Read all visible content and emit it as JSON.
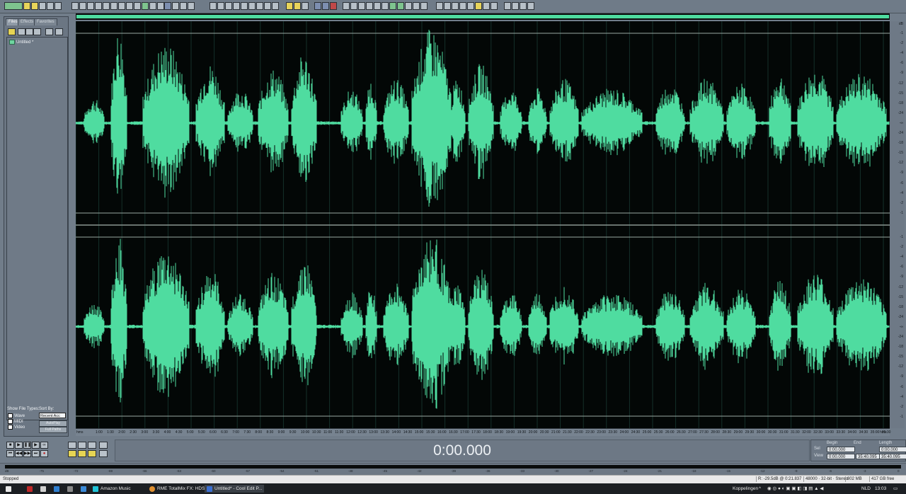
{
  "organizer": {
    "tabs": [
      "Files",
      "Effects",
      "Favorites"
    ],
    "files": [
      "Untitled *"
    ],
    "show_file_types_label": "Show File Types:",
    "sort_by_label": "Sort By:",
    "sort_value": "Recent Acc",
    "file_types": [
      "Wave",
      "MIDI",
      "Video"
    ],
    "autoplay_label": "AutoPlay",
    "full_paths_label": "Full Paths"
  },
  "time_display": "0:00.000",
  "selection": {
    "headers": [
      "Begin",
      "End",
      "Length"
    ],
    "sel_label": "Sel",
    "view_label": "View",
    "sel": [
      "0:00.000",
      "",
      "0:00.000"
    ],
    "view": [
      "0:00.000",
      "35:40.095",
      "35:40.095"
    ]
  },
  "ruler": {
    "left_label": "hms",
    "right_label": "hms",
    "ticks": [
      "1:00",
      "1:30",
      "2:00",
      "2:30",
      "3:00",
      "3:30",
      "4:00",
      "4:30",
      "5:00",
      "5:30",
      "6:00",
      "6:30",
      "7:00",
      "7:30",
      "8:00",
      "8:30",
      "9:00",
      "9:30",
      "10:00",
      "10:30",
      "11:00",
      "11:30",
      "12:00",
      "12:30",
      "13:00",
      "13:30",
      "14:00",
      "14:30",
      "15:00",
      "15:30",
      "16:00",
      "16:30",
      "17:00",
      "17:30",
      "18:00",
      "18:30",
      "19:00",
      "19:30",
      "20:00",
      "20:30",
      "21:00",
      "21:30",
      "22:00",
      "22:30",
      "23:00",
      "23:30",
      "24:00",
      "24:30",
      "25:00",
      "25:30",
      "26:00",
      "26:30",
      "27:00",
      "27:30",
      "28:00",
      "28:30",
      "29:00",
      "29:30",
      "30:00",
      "30:30",
      "31:00",
      "31:30",
      "32:00",
      "32:30",
      "33:00",
      "33:30",
      "34:00",
      "34:30",
      "35:00",
      "35:30"
    ]
  },
  "db_scale": {
    "top_label": "dB",
    "ch1": [
      "-1",
      "-2",
      "-4",
      "-6",
      "-9",
      "-12",
      "-15",
      "-18",
      "-24",
      "-∞",
      "-24",
      "-18",
      "-15",
      "-12",
      "-9",
      "-6",
      "-4",
      "-2",
      "-1"
    ],
    "ch2": [
      "-1",
      "-2",
      "-4",
      "-6",
      "-9",
      "-12",
      "-15",
      "-18",
      "-24",
      "-∞",
      "-24",
      "-18",
      "-15",
      "-12",
      "-9",
      "-6",
      "-4",
      "-2",
      "-1"
    ]
  },
  "meter_labels": [
    "dB",
    "-75",
    "-72",
    "-69",
    "-66",
    "-63",
    "-60",
    "-57",
    "-54",
    "-51",
    "-48",
    "-45",
    "-42",
    "-39",
    "-36",
    "-33",
    "-30",
    "-27",
    "-24",
    "-21",
    "-18",
    "-15",
    "-12",
    "-9",
    "-6",
    "-3",
    "0"
  ],
  "status": {
    "state": "Stopped",
    "cursor": "R: -29.5dB @  0:21.837",
    "sample_rate": "48000 · 32-bit · Stereo",
    "size": "802 MB",
    "free": "417 GB free"
  },
  "taskbar": {
    "items": [
      "Amazon Music",
      "RME TotalMix FX: HDS...",
      "Untitled* - Cool Edit P..."
    ],
    "network_label": "Koppelingen",
    "lang": "NLD",
    "clock": "13:03"
  },
  "colors": {
    "waveform": "#4fdca0",
    "wave_bg": "#030706",
    "panel": "#717d8a"
  }
}
